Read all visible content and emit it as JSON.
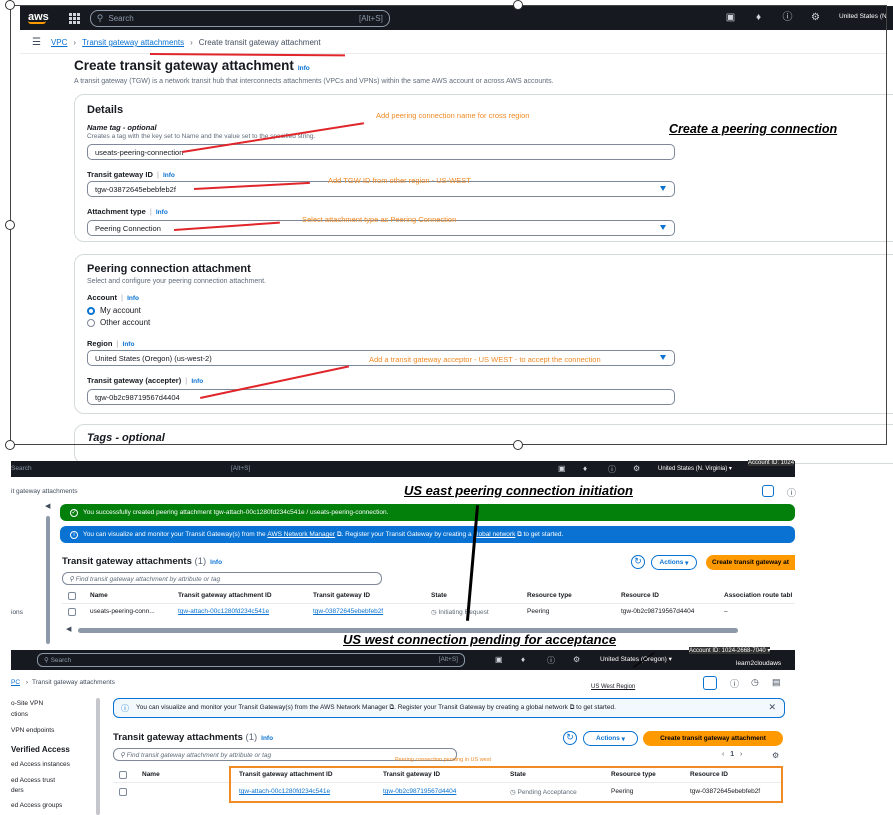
{
  "nav": {
    "logo": "aws",
    "search_placeholder": "Search",
    "search_shortcut": "[Alt+S]",
    "region_text": "United States (N"
  },
  "breadcrumb": {
    "vpc": "VPC",
    "tga": "Transit gateway attachments",
    "current": "Create transit gateway attachment"
  },
  "page": {
    "title": "Create transit gateway attachment",
    "info": "Info",
    "description": "A transit gateway (TGW) is a network transit hub that interconnects attachments (VPCs and VPNs) within the same AWS account or across AWS accounts."
  },
  "details": {
    "heading": "Details",
    "name_tag_label": "Name tag - optional",
    "name_tag_desc": "Creates a tag with the key set to Name and the value set to the specified string.",
    "name_tag_value": "useats-peering-connection",
    "tgw_id_label": "Transit gateway ID",
    "tgw_id_value": "tgw-03872645ebebfeb2f",
    "attachment_type_label": "Attachment type",
    "attachment_type_value": "Peering Connection"
  },
  "peering": {
    "heading": "Peering connection attachment",
    "desc": "Select and configure your peering connection attachment.",
    "account_label": "Account",
    "my_account": "My account",
    "other_account": "Other account",
    "region_label": "Region",
    "region_value": "United States (Oregon) (us-west-2)",
    "accepter_label": "Transit gateway (accepter)",
    "accepter_value": "tgw-0b2c98719567d4404"
  },
  "tags": {
    "heading": "Tags - optional"
  },
  "annotations": {
    "a1": "Add peering connection name for cross region",
    "a2": "Add TGW ID from other region - US-WEST",
    "a3": "Select attachment type as Peering Connection",
    "a4": "Add a transit gateway acceptor - US WEST - to accept the connection",
    "big1": "Create a peering connection",
    "big2": "US east peering connection initiation",
    "big3": "US west connection pending for acceptance",
    "small_west": "US West Region",
    "pending_note": "Peering connection pending in US west"
  },
  "east": {
    "search_placeholder": "Search",
    "search_shortcut": "[Alt+S]",
    "region": "United States (N. Virginia) ▾",
    "account": "Account ID: 1024",
    "crumb": "it gateway attachments",
    "success_msg": "You successfully created peering attachment tgw-attach-00c1280fd234c541e / useats-peering-connection.",
    "info_msg_1": "You can visualize and monitor your Transit Gateway(s) from the",
    "info_link_1": "AWS Network Manager",
    "info_msg_2": ". Register your Transit Gateway by cr",
    "info_msg_3": "eating a",
    "info_link_2": "global network",
    "info_msg_4": "to get started.",
    "table_title": "Transit gateway attachments",
    "count": "(1)",
    "actions": "Actions",
    "create": "Create transit gateway at",
    "filter": "Find transit gateway attachment by attribute or tag",
    "cols": [
      "Name",
      "Transit gateway attachment ID",
      "Transit gateway ID",
      "State",
      "Resource type",
      "Resource ID",
      "Association route tabl"
    ],
    "row": [
      "useats-peering-conn...",
      "tgw-attach-00c1280fd234c541e",
      "tgw-03872645ebebfeb2f",
      "Initiating Request",
      "Peering",
      "tgw-0b2c98719567d4404",
      "–"
    ],
    "side": "ions"
  },
  "west": {
    "search_placeholder": "Search",
    "search_shortcut": "[Alt+S]",
    "region": "United States (Oregon) ▾",
    "account": "Account ID: 1024-2668-7040 ▾",
    "user": "learn2cloudaws",
    "crumb_vpc": "PC",
    "crumb": "Transit gateway attachments",
    "info_msg": "You can visualize and monitor your Transit Gateway(s) from the AWS Network Manager ⧉. Register your Transit Gateway by creating a global network ⧉ to get started.",
    "table_title": "Transit gateway attachments",
    "count": "(1)",
    "info": "Info",
    "actions": "Actions",
    "create": "Create transit gateway attachment",
    "filter": "Find transit gateway attachment by attribute or tag",
    "page": "1",
    "cols": [
      "Name",
      "Transit gateway attachment ID",
      "Transit gateway ID",
      "State",
      "Resource type",
      "Resource ID"
    ],
    "row": [
      "tgw-attach-00c1280fd234c541e",
      "tgw-0b2c98719567d4404",
      "Pending Acceptance",
      "Peering",
      "tgw-03872645ebebfeb2f"
    ],
    "side": [
      "o-Site VPN",
      "ctions",
      "VPN endpoints",
      "Verified Access",
      "ed Access instances",
      "ed Access trust",
      "ders",
      "ed Access groups"
    ]
  }
}
